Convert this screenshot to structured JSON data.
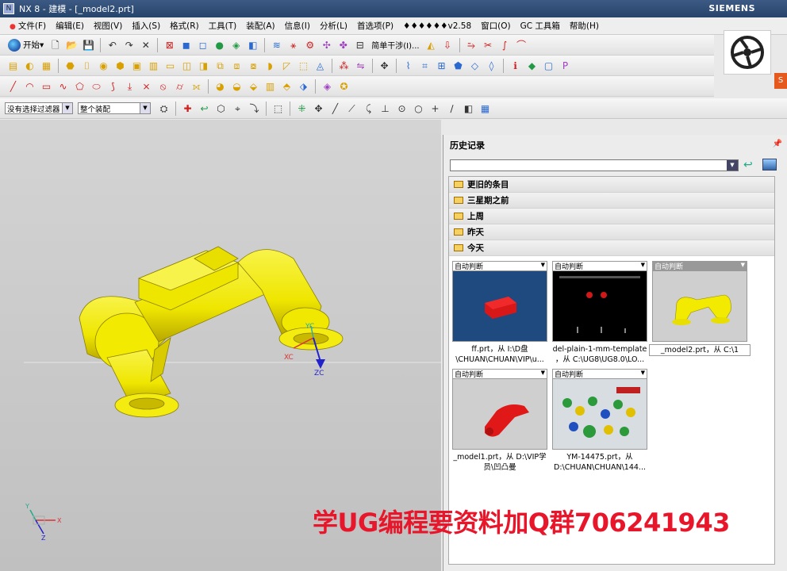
{
  "window": {
    "title": "NX 8 - 建模 - [_model2.prt]",
    "brand": "SIEMENS"
  },
  "menu": [
    "文件(F)",
    "编辑(E)",
    "视图(V)",
    "插入(S)",
    "格式(R)",
    "工具(T)",
    "装配(A)",
    "信息(I)",
    "分析(L)",
    "首选项(P)",
    "♦♦♦♦♦♦v2.58",
    "窗口(O)",
    "GC 工具箱",
    "帮助(H)"
  ],
  "toolbar": {
    "start_label": "开始▾",
    "step_label": "简单干涉(I)..."
  },
  "selection": {
    "filter": "没有选择过滤器",
    "scope": "整个装配"
  },
  "viewport": {
    "datum_labels": {
      "yc": "YC",
      "xc": "XC",
      "zc": "ZC"
    },
    "triad_labels": {
      "x": "X",
      "y": "Y",
      "z": "Z"
    }
  },
  "watermark": "学UG编程要资料加Q群706241943",
  "history": {
    "title": "历史记录",
    "groups": [
      "更旧的条目",
      "三星期之前",
      "上周",
      "昨天",
      "今天"
    ],
    "cards": [
      {
        "caption": "自动判断",
        "line1": "ff.prt，从 I:\\D盘",
        "line2": "\\CHUAN\\CHUAN\\VIP\\u...",
        "thumb": "red-block"
      },
      {
        "caption": "自动判断",
        "line1": "del-plain-1-mm-template",
        "line2": "，从 C:\\UG8\\UG8.0\\LO...",
        "thumb": "black-template"
      },
      {
        "caption": "自动判断",
        "line1": "_model2.prt，从 C:\\1",
        "line2": "",
        "thumb": "yellow-pipe"
      },
      {
        "caption": "自动判断",
        "line1": "_model1.prt，从 D:\\VIP学",
        "line2": "员\\凹凸曼",
        "thumb": "red-lever"
      },
      {
        "caption": "自动判断",
        "line1": "YM-14475.prt，从",
        "line2": "D:\\CHUAN\\CHUAN\\144...",
        "thumb": "assembly"
      }
    ]
  },
  "colors": {
    "accent_yellow": "#f2ea00",
    "watermark_red": "#e8162a",
    "viewport_bg": "#c8c8c8"
  }
}
